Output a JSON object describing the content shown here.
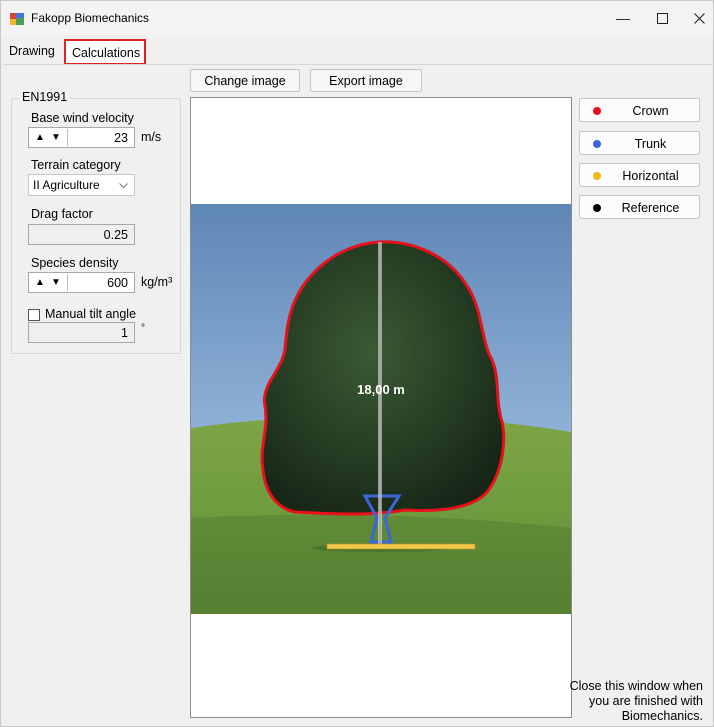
{
  "window": {
    "title": "Fakopp Biomechanics"
  },
  "tabs": [
    {
      "label": "Drawing"
    },
    {
      "label": "Calculations"
    }
  ],
  "toolbar": {
    "change_image": "Change image",
    "export_image": "Export image"
  },
  "params": {
    "group_title": "EN1991",
    "base_wind_velocity": {
      "label": "Base wind velocity",
      "value": "23",
      "unit": "m/s"
    },
    "terrain_category": {
      "label": "Terrain category",
      "value": "II Agriculture"
    },
    "drag_factor": {
      "label": "Drag factor",
      "value": "0.25"
    },
    "species_density": {
      "label": "Species density",
      "value": "600",
      "unit": "kg/m³"
    },
    "manual_tilt": {
      "label": "Manual tilt angle",
      "checked": false,
      "value": "1",
      "unit": "°"
    }
  },
  "drawing": {
    "height_label": "18,00 m"
  },
  "legend": [
    {
      "label": "Crown",
      "color": "#e8101a"
    },
    {
      "label": "Trunk",
      "color": "#3a66d8"
    },
    {
      "label": "Horizontal",
      "color": "#f2b51c"
    },
    {
      "label": "Reference",
      "color": "#000000"
    }
  ],
  "footer_note": "Close this window when you are finished with Biomechanics.",
  "colors": {
    "crown": "#e8101a",
    "trunk": "#3a66d8",
    "horizontal": "#f2c84a",
    "highlight": "#d22222"
  }
}
